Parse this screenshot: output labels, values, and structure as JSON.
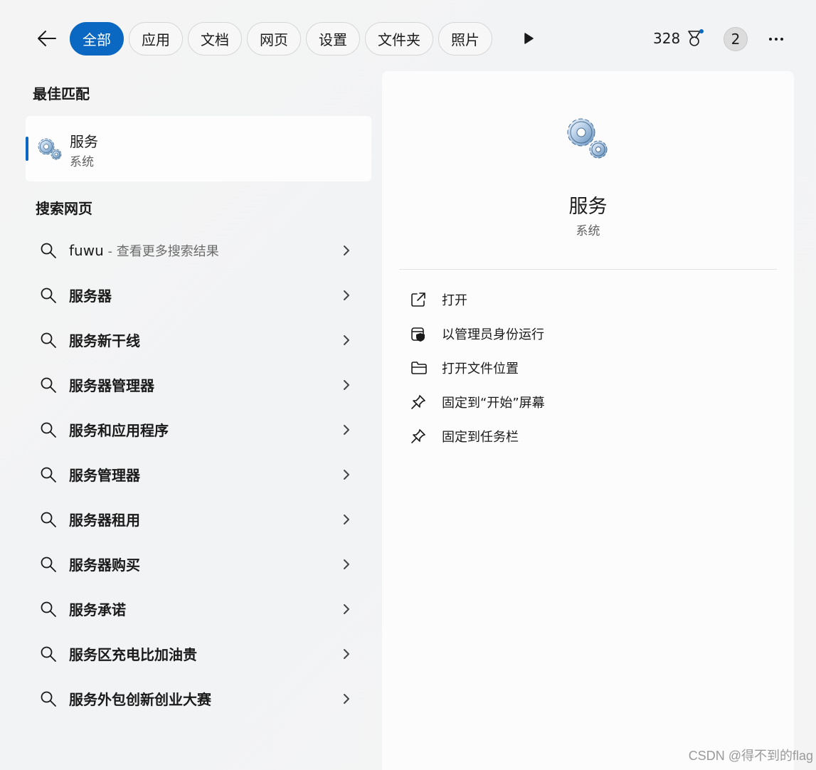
{
  "topbar": {
    "filters": [
      {
        "label": "全部",
        "active": true
      },
      {
        "label": "应用",
        "active": false
      },
      {
        "label": "文档",
        "active": false
      },
      {
        "label": "网页",
        "active": false
      },
      {
        "label": "设置",
        "active": false
      },
      {
        "label": "文件夹",
        "active": false
      },
      {
        "label": "照片",
        "active": false
      }
    ],
    "points": "328",
    "account_badge": "2"
  },
  "best_match": {
    "title": "最佳匹配",
    "name": "服务",
    "type": "系统",
    "icon": "services-gear-icon"
  },
  "web_search": {
    "title": "搜索网页",
    "first": {
      "query": "fuwu",
      "suffix": " - 查看更多搜索结果"
    },
    "suggestions": [
      "服务器",
      "服务新干线",
      "服务器管理器",
      "服务和应用程序",
      "服务管理器",
      "服务器租用",
      "服务器购买",
      "服务承诺",
      "服务区充电比加油贵",
      "服务外包创新创业大赛"
    ]
  },
  "detail": {
    "name": "服务",
    "type": "系统",
    "actions": [
      {
        "label": "打开",
        "icon": "open-external-icon"
      },
      {
        "label": "以管理员身份运行",
        "icon": "shield-admin-icon"
      },
      {
        "label": "打开文件位置",
        "icon": "folder-icon"
      },
      {
        "label": "固定到“开始”屏幕",
        "icon": "pin-icon"
      },
      {
        "label": "固定到任务栏",
        "icon": "pin-icon"
      }
    ]
  },
  "watermark": "CSDN @得不到的flag",
  "colors": {
    "accent": "#0a67c2",
    "background": "#f3f3f3",
    "panel": "#fcfcfc"
  }
}
